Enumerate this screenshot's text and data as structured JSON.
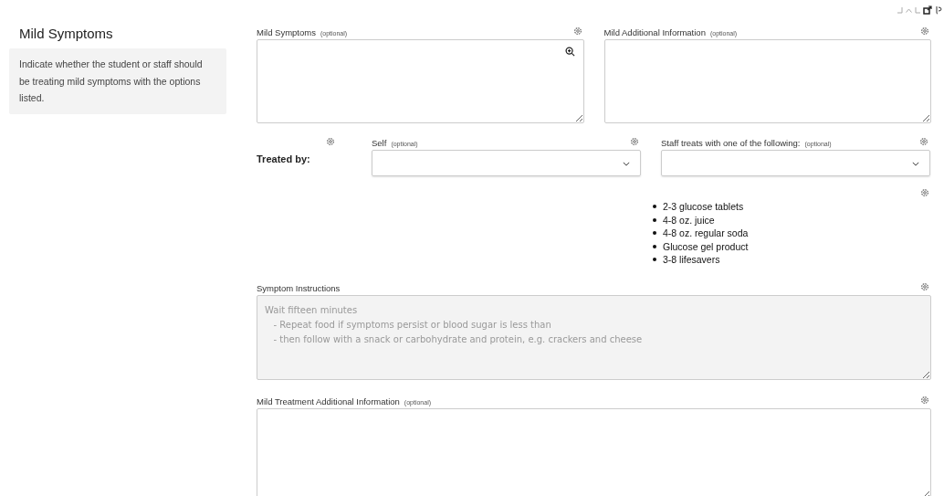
{
  "section": {
    "title": "Mild Symptoms",
    "description": "Indicate whether the student or staff should be treating mild symptoms with the options listed."
  },
  "top_row": [
    {
      "kind": "textarea",
      "label": "Mild Symptoms",
      "tag": "(optional)",
      "zoom": true,
      "disabled": false
    },
    {
      "kind": "textarea",
      "label": "Mild Additional Information",
      "tag": "(optional)",
      "zoom": false,
      "disabled": false
    }
  ],
  "treated_by": {
    "label": "Treated by:",
    "selects": [
      {
        "kind": "select",
        "label": "Self",
        "tag": "(optional)"
      },
      {
        "kind": "select",
        "label": "Staff treats with one of the following:",
        "tag": "(optional)"
      }
    ]
  },
  "treatment_list": [
    "2-3 glucose tablets",
    "4-8 oz. juice",
    "4-8 oz. regular soda",
    "Glucose gel product",
    "3-8 lifesavers"
  ],
  "instructions": {
    "label": "Symptom Instructions",
    "disabled": true,
    "value": "Wait fifteen minutes\n   - Repeat food if symptoms persist or blood sugar is less than\n   - then follow with a snack or carbohydrate and protein, e.g. crackers and cheese"
  },
  "additional": {
    "label": "Mild Treatment Additional Information",
    "tag": "(optional)",
    "disabled": false
  }
}
